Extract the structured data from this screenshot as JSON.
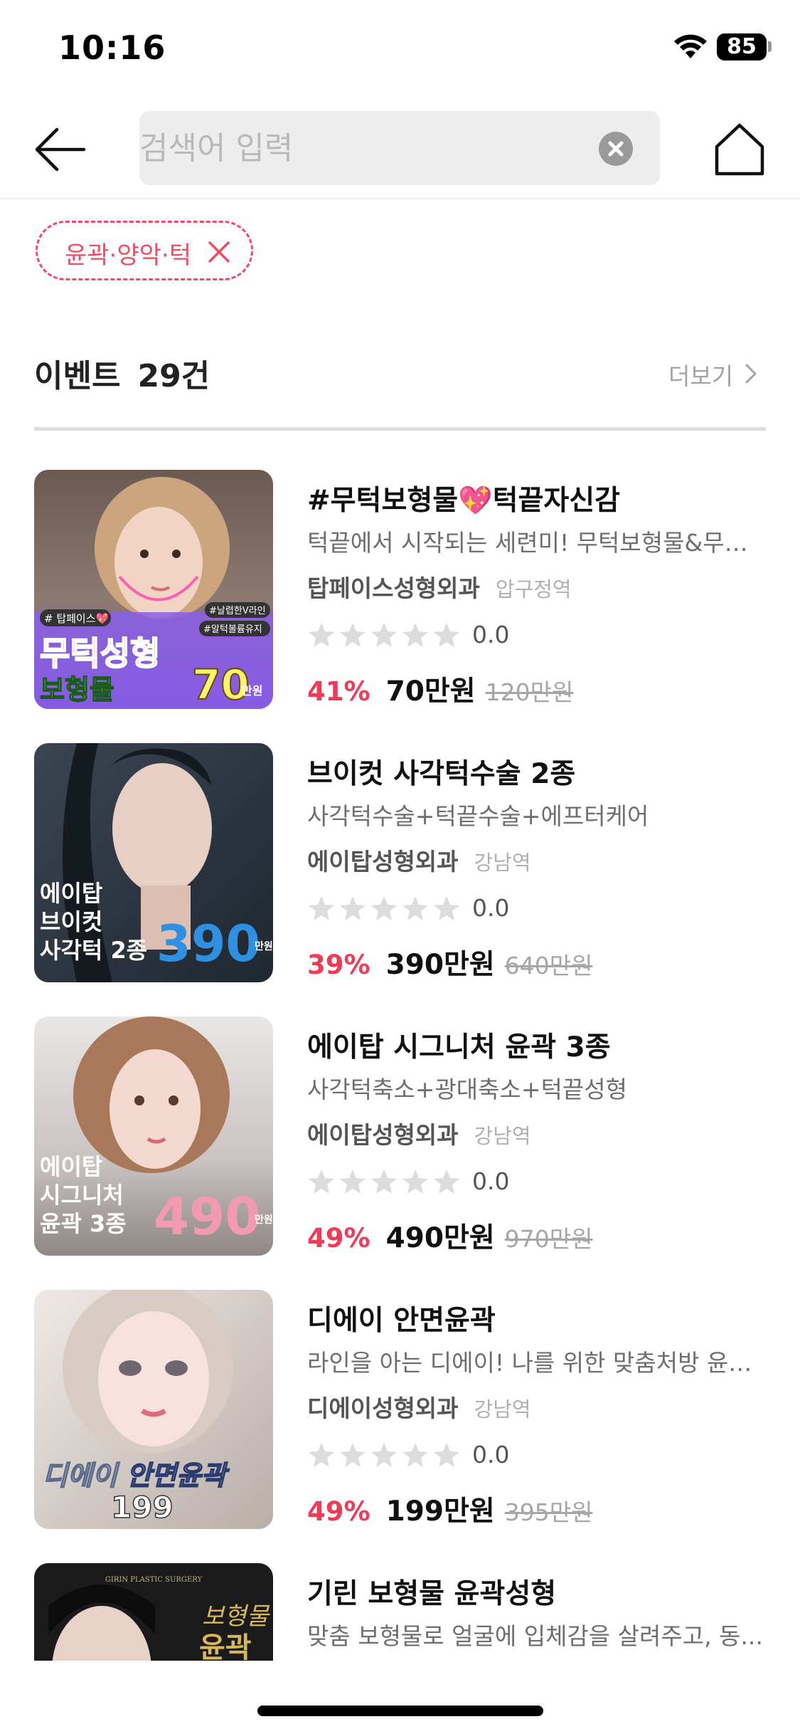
{
  "status_bar": {
    "time": "10:16",
    "battery": "85"
  },
  "search": {
    "placeholder": "검색어 입력",
    "value": ""
  },
  "filter_chip": {
    "label": "윤곽·양악·턱"
  },
  "section": {
    "title": "이벤트",
    "count": "29건",
    "more_label": "더보기"
  },
  "events": [
    {
      "title": "#무턱보형물💖턱끝자신감",
      "description": "턱끝에서 시작되는 세련미! 무턱보형물&무턱...",
      "hospital": "탑페이스성형외과",
      "station": "압구정역",
      "rating": "0.0",
      "discount": "41%",
      "price": "70만원",
      "original_price": "120만원",
      "thumb_text": {
        "tag1": "# 탑페이스💖",
        "tag2": "#날렵한V라인",
        "tag3": "#알턱볼륨유지",
        "line1": "무턱성형",
        "line2": "보형물",
        "price": "70",
        "unit": "만원"
      }
    },
    {
      "title": "브이컷 사각턱수술 2종",
      "description": "사각턱수술+턱끝수술+에프터케어",
      "hospital": "에이탑성형외과",
      "station": "강남역",
      "rating": "0.0",
      "discount": "39%",
      "price": "390만원",
      "original_price": "640만원",
      "thumb_text": {
        "line1": "에이탑",
        "line2": "브이컷",
        "line3": "사각턱 2종",
        "price": "390",
        "unit": "만원"
      }
    },
    {
      "title": "에이탑 시그니처 윤곽 3종",
      "description": "사각턱축소+광대축소+턱끝성형",
      "hospital": "에이탑성형외과",
      "station": "강남역",
      "rating": "0.0",
      "discount": "49%",
      "price": "490만원",
      "original_price": "970만원",
      "thumb_text": {
        "line1": "에이탑",
        "line2": "시그니처",
        "line3": "윤곽 3종",
        "price": "490",
        "unit": "만원"
      }
    },
    {
      "title": "디에이 안면윤곽",
      "description": "라인을 아는 디에이! 나를 위한 맞춤처방 윤곽...",
      "hospital": "디에이성형외과",
      "station": "강남역",
      "rating": "0.0",
      "discount": "49%",
      "price": "199만원",
      "original_price": "395만원",
      "thumb_text": {
        "line1": "디에이",
        "line2": "안면윤곽",
        "price": "199"
      }
    },
    {
      "title": "기린 보형물 윤곽성형",
      "description": "맞춤 보형물로 얼굴에 입체감을 살려주고, 동...",
      "thumb_text": {
        "top": "GIRIN PLASTIC SURGERY",
        "line1": "보형물",
        "line2": "윤곽"
      }
    }
  ],
  "colors": {
    "accent": "#ee3b56",
    "chip": "#ee4d64",
    "star_empty": "#dcdcdc"
  },
  "icons": {
    "back": "arrow-left-icon",
    "clear": "clear-x-icon",
    "home": "home-icon",
    "chip_remove": "close-x-icon",
    "more": "chevron-right-icon",
    "wifi": "wifi-icon",
    "star": "star-icon"
  }
}
